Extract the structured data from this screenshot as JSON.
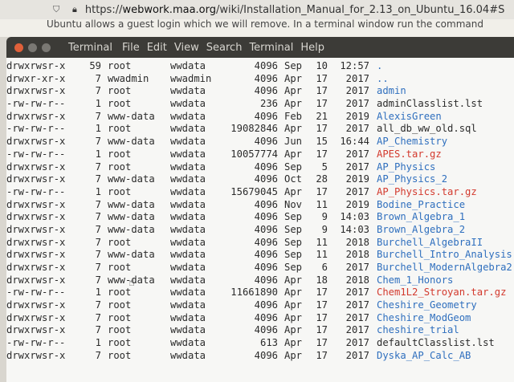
{
  "browser": {
    "url_prefix": "https://",
    "url_domain": "webwork.maa.org",
    "url_path": "/wiki/Installation_Manual_for_2.13_on_Ubuntu_16.04#S"
  },
  "page": {
    "visible_text": "Ubuntu allows a guest login which we will remove. In a terminal window run the command"
  },
  "terminal": {
    "menus": [
      "Terminal",
      "File",
      "Edit",
      "View",
      "Search",
      "Terminal",
      "Help"
    ],
    "rows": [
      {
        "perm": "drwxrwsr-x",
        "links": "59",
        "owner": "root",
        "group": "wwdata",
        "size": "4096",
        "month": "Sep",
        "day": "10",
        "time": "12:57",
        "name": ".",
        "type": "dir"
      },
      {
        "perm": "drwxr-xr-x",
        "links": "7",
        "owner": "wwadmin",
        "group": "wwadmin",
        "size": "4096",
        "month": "Apr",
        "day": "17",
        "time": "2017",
        "name": "..",
        "type": "dir"
      },
      {
        "perm": "drwxrwsr-x",
        "links": "7",
        "owner": "root",
        "group": "wwdata",
        "size": "4096",
        "month": "Apr",
        "day": "17",
        "time": "2017",
        "name": "admin",
        "type": "dir"
      },
      {
        "perm": "-rw-rw-r--",
        "links": "1",
        "owner": "root",
        "group": "wwdata",
        "size": "236",
        "month": "Apr",
        "day": "17",
        "time": "2017",
        "name": "adminClasslist.lst",
        "type": "file"
      },
      {
        "perm": "drwxrwsr-x",
        "links": "7",
        "owner": "www-data",
        "group": "wwdata",
        "size": "4096",
        "month": "Feb",
        "day": "21",
        "time": "2019",
        "name": "AlexisGreen",
        "type": "dir"
      },
      {
        "perm": "-rw-rw-r--",
        "links": "1",
        "owner": "root",
        "group": "wwdata",
        "size": "19082846",
        "month": "Apr",
        "day": "17",
        "time": "2017",
        "name": "all_db_ww_old.sql",
        "type": "file"
      },
      {
        "perm": "drwxrwsr-x",
        "links": "7",
        "owner": "www-data",
        "group": "wwdata",
        "size": "4096",
        "month": "Jun",
        "day": "15",
        "time": "16:44",
        "name": "AP_Chemistry",
        "type": "dir"
      },
      {
        "perm": "-rw-rw-r--",
        "links": "1",
        "owner": "root",
        "group": "wwdata",
        "size": "10057774",
        "month": "Apr",
        "day": "17",
        "time": "2017",
        "name": "APES.tar.gz",
        "type": "archive"
      },
      {
        "perm": "drwxrwsr-x",
        "links": "7",
        "owner": "root",
        "group": "wwdata",
        "size": "4096",
        "month": "Sep",
        "day": "5",
        "time": "2017",
        "name": "AP_Physics",
        "type": "dir"
      },
      {
        "perm": "drwxrwsr-x",
        "links": "7",
        "owner": "www-data",
        "group": "wwdata",
        "size": "4096",
        "month": "Oct",
        "day": "28",
        "time": "2019",
        "name": "AP_Physics_2",
        "type": "dir"
      },
      {
        "perm": "-rw-rw-r--",
        "links": "1",
        "owner": "root",
        "group": "wwdata",
        "size": "15679045",
        "month": "Apr",
        "day": "17",
        "time": "2017",
        "name": "AP_Physics.tar.gz",
        "type": "archive"
      },
      {
        "perm": "drwxrwsr-x",
        "links": "7",
        "owner": "www-data",
        "group": "wwdata",
        "size": "4096",
        "month": "Nov",
        "day": "11",
        "time": "2019",
        "name": "Bodine_Practice",
        "type": "dir"
      },
      {
        "perm": "drwxrwsr-x",
        "links": "7",
        "owner": "www-data",
        "group": "wwdata",
        "size": "4096",
        "month": "Sep",
        "day": "9",
        "time": "14:03",
        "name": "Brown_Algebra_1",
        "type": "dir"
      },
      {
        "perm": "drwxrwsr-x",
        "links": "7",
        "owner": "www-data",
        "group": "wwdata",
        "size": "4096",
        "month": "Sep",
        "day": "9",
        "time": "14:03",
        "name": "Brown_Algebra_2",
        "type": "dir"
      },
      {
        "perm": "drwxrwsr-x",
        "links": "7",
        "owner": "root",
        "group": "wwdata",
        "size": "4096",
        "month": "Sep",
        "day": "11",
        "time": "2018",
        "name": "Burchell_AlgebraII",
        "type": "dir"
      },
      {
        "perm": "drwxrwsr-x",
        "links": "7",
        "owner": "www-data",
        "group": "wwdata",
        "size": "4096",
        "month": "Sep",
        "day": "11",
        "time": "2018",
        "name": "Burchell_Intro_Analysis",
        "type": "dir"
      },
      {
        "perm": "drwxrwsr-x",
        "links": "7",
        "owner": "root",
        "group": "wwdata",
        "size": "4096",
        "month": "Sep",
        "day": "6",
        "time": "2017",
        "name": "Burchell_ModernAlgebra2",
        "type": "dir"
      },
      {
        "perm": "drwxrwsr-x",
        "links": "7",
        "owner": "www-data",
        "group": "wwdata",
        "size": "4096",
        "month": "Apr",
        "day": "18",
        "time": "2018",
        "name": "Chem_1_Honors",
        "type": "dir"
      },
      {
        "perm": "-rw-rw-r--",
        "links": "1",
        "owner": "root",
        "group": "wwdata",
        "size": "11661890",
        "month": "Apr",
        "day": "17",
        "time": "2017",
        "name": "Chem1L2_Stroyan.tar.gz",
        "type": "archive"
      },
      {
        "perm": "drwxrwsr-x",
        "links": "7",
        "owner": "root",
        "group": "wwdata",
        "size": "4096",
        "month": "Apr",
        "day": "17",
        "time": "2017",
        "name": "Cheshire_Geometry",
        "type": "dir"
      },
      {
        "perm": "drwxrwsr-x",
        "links": "7",
        "owner": "root",
        "group": "wwdata",
        "size": "4096",
        "month": "Apr",
        "day": "17",
        "time": "2017",
        "name": "Cheshire_ModGeom",
        "type": "dir"
      },
      {
        "perm": "drwxrwsr-x",
        "links": "7",
        "owner": "root",
        "group": "wwdata",
        "size": "4096",
        "month": "Apr",
        "day": "17",
        "time": "2017",
        "name": "cheshire_trial",
        "type": "dir"
      },
      {
        "perm": "-rw-rw-r--",
        "links": "1",
        "owner": "root",
        "group": "wwdata",
        "size": "613",
        "month": "Apr",
        "day": "17",
        "time": "2017",
        "name": "defaultClasslist.lst",
        "type": "file"
      },
      {
        "perm": "drwxrwsr-x",
        "links": "7",
        "owner": "root",
        "group": "wwdata",
        "size": "4096",
        "month": "Apr",
        "day": "17",
        "time": "2017",
        "name": "Dyska_AP_Calc_AB",
        "type": "dir"
      }
    ]
  },
  "colors": {
    "directory": "#2f6fbe",
    "archive": "#d33a2e",
    "file": "#2b2b2b",
    "menubar": "#3c3b37"
  }
}
